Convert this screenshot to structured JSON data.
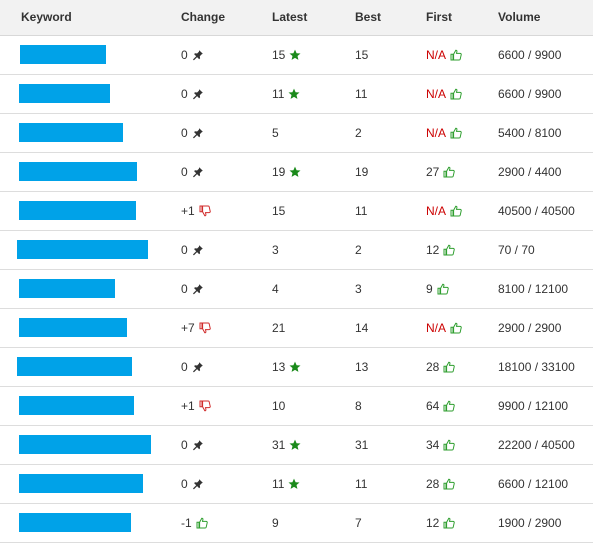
{
  "colors": {
    "keyword_bar": "#00a2e8",
    "star": "#1a8a1a",
    "thumbs_up": "#2e9e2e",
    "thumbs_down": "#d02a2a",
    "na_text": "#cc0000",
    "header_bg": "#f2f2f2"
  },
  "header": {
    "keyword": "Keyword",
    "change": "Change",
    "latest": "Latest",
    "best": "Best",
    "first": "First",
    "volume": "Volume"
  },
  "rows": [
    {
      "keyword": "",
      "change": "0",
      "change_icon": "pin-icon",
      "latest": "15",
      "latest_icon": "star-icon",
      "best": "15",
      "first": "N/A",
      "first_icon": "thumbs-up-icon",
      "volume": "6600 / 9900"
    },
    {
      "keyword": "",
      "change": "0",
      "change_icon": "pin-icon",
      "latest": "11",
      "latest_icon": "star-icon",
      "best": "11",
      "first": "N/A",
      "first_icon": "thumbs-up-icon",
      "volume": "6600 / 9900"
    },
    {
      "keyword": "",
      "change": "0",
      "change_icon": "pin-icon",
      "latest": "5",
      "latest_icon": "",
      "best": "2",
      "first": "N/A",
      "first_icon": "thumbs-up-icon",
      "volume": "5400 / 8100"
    },
    {
      "keyword": "",
      "change": "0",
      "change_icon": "pin-icon",
      "latest": "19",
      "latest_icon": "star-icon",
      "best": "19",
      "first": "27",
      "first_icon": "thumbs-up-icon",
      "volume": "2900 / 4400"
    },
    {
      "keyword": "",
      "change": "+1",
      "change_icon": "thumbs-down-icon",
      "latest": "15",
      "latest_icon": "",
      "best": "11",
      "first": "N/A",
      "first_icon": "thumbs-up-icon",
      "volume": "40500 / 40500"
    },
    {
      "keyword": "",
      "change": "0",
      "change_icon": "pin-icon",
      "latest": "3",
      "latest_icon": "",
      "best": "2",
      "first": "12",
      "first_icon": "thumbs-up-icon",
      "volume": "70 / 70"
    },
    {
      "keyword": "",
      "change": "0",
      "change_icon": "pin-icon",
      "latest": "4",
      "latest_icon": "",
      "best": "3",
      "first": "9",
      "first_icon": "thumbs-up-icon",
      "volume": "8100 / 12100"
    },
    {
      "keyword": "",
      "change": "+7",
      "change_icon": "thumbs-down-icon",
      "latest": "21",
      "latest_icon": "",
      "best": "14",
      "first": "N/A",
      "first_icon": "thumbs-up-icon",
      "volume": "2900 / 2900"
    },
    {
      "keyword": "",
      "change": "0",
      "change_icon": "pin-icon",
      "latest": "13",
      "latest_icon": "star-icon",
      "best": "13",
      "first": "28",
      "first_icon": "thumbs-up-icon",
      "volume": "18100 / 33100"
    },
    {
      "keyword": "",
      "change": "+1",
      "change_icon": "thumbs-down-icon",
      "latest": "10",
      "latest_icon": "",
      "best": "8",
      "first": "64",
      "first_icon": "thumbs-up-icon",
      "volume": "9900 / 12100"
    },
    {
      "keyword": "",
      "change": "0",
      "change_icon": "pin-icon",
      "latest": "31",
      "latest_icon": "star-icon",
      "best": "31",
      "first": "34",
      "first_icon": "thumbs-up-icon",
      "volume": "22200 / 40500"
    },
    {
      "keyword": "",
      "change": "0",
      "change_icon": "pin-icon",
      "latest": "11",
      "latest_icon": "star-icon",
      "best": "11",
      "first": "28",
      "first_icon": "thumbs-up-icon",
      "volume": "6600 / 12100"
    },
    {
      "keyword": "",
      "change": "-1",
      "change_icon": "thumbs-up-icon",
      "latest": "9",
      "latest_icon": "",
      "best": "7",
      "first": "12",
      "first_icon": "thumbs-up-icon",
      "volume": "1900 / 2900"
    }
  ]
}
